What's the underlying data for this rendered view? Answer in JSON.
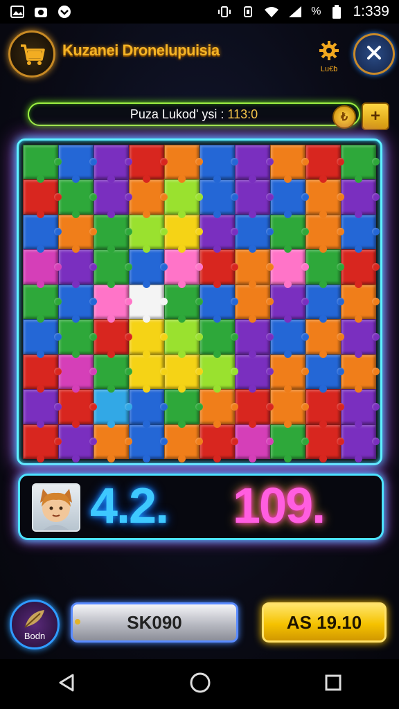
{
  "status_bar": {
    "time": "1:339",
    "battery_pct": "%",
    "left_icons": [
      "gallery-icon",
      "camera-icon",
      "chevron-badge-icon"
    ],
    "right_icons": [
      "vibrate-icon",
      "rotate-icon",
      "wifi-icon",
      "signal-icon",
      "battery-icon"
    ]
  },
  "header": {
    "title": "Kuzanei Dronelupuisia",
    "settings_label": "Lu€ɓ",
    "logo_icon": "cart-logo-icon",
    "close_icon": "close-icon"
  },
  "progress": {
    "label": "Puza Lukod' ysi : ",
    "value": "113:0",
    "coin_symbol": "₺",
    "plus_symbol": "+"
  },
  "board": {
    "colors": {
      "red": "#d8261f",
      "orange": "#f07e1a",
      "yellow": "#f5d316",
      "green": "#2ea83a",
      "lime": "#9ae12f",
      "blue": "#2467d6",
      "cyan": "#32a8e6",
      "purple": "#7a2fbf",
      "magenta": "#d53fb8",
      "pink": "#ff74c8",
      "white": "#f4f4f4"
    },
    "rows": [
      [
        "green",
        "blue",
        "purple",
        "red",
        "orange",
        "blue",
        "purple",
        "orange",
        "red",
        "green"
      ],
      [
        "red",
        "green",
        "purple",
        "orange",
        "lime",
        "blue",
        "purple",
        "blue",
        "orange",
        "purple"
      ],
      [
        "blue",
        "orange",
        "green",
        "lime",
        "yellow",
        "purple",
        "blue",
        "green",
        "orange",
        "blue"
      ],
      [
        "magenta",
        "purple",
        "green",
        "blue",
        "pink",
        "red",
        "orange",
        "pink",
        "green",
        "red"
      ],
      [
        "green",
        "blue",
        "pink",
        "white",
        "green",
        "blue",
        "orange",
        "purple",
        "blue",
        "orange"
      ],
      [
        "blue",
        "green",
        "red",
        "yellow",
        "lime",
        "green",
        "purple",
        "blue",
        "orange",
        "purple"
      ],
      [
        "red",
        "magenta",
        "green",
        "yellow",
        "yellow",
        "lime",
        "purple",
        "orange",
        "blue",
        "orange"
      ],
      [
        "purple",
        "red",
        "cyan",
        "blue",
        "green",
        "orange",
        "red",
        "orange",
        "red",
        "purple"
      ],
      [
        "red",
        "purple",
        "orange",
        "blue",
        "orange",
        "red",
        "magenta",
        "green",
        "red",
        "purple"
      ]
    ]
  },
  "scores": {
    "player_a": "4.2.",
    "player_b": "109."
  },
  "bottom": {
    "circle_label": "Bodn",
    "silver_label": "SK090",
    "gold_label": "AS 19.10"
  },
  "nav": {
    "back_icon": "back-triangle-icon",
    "home_icon": "home-circle-icon",
    "recents_icon": "recents-square-icon"
  }
}
